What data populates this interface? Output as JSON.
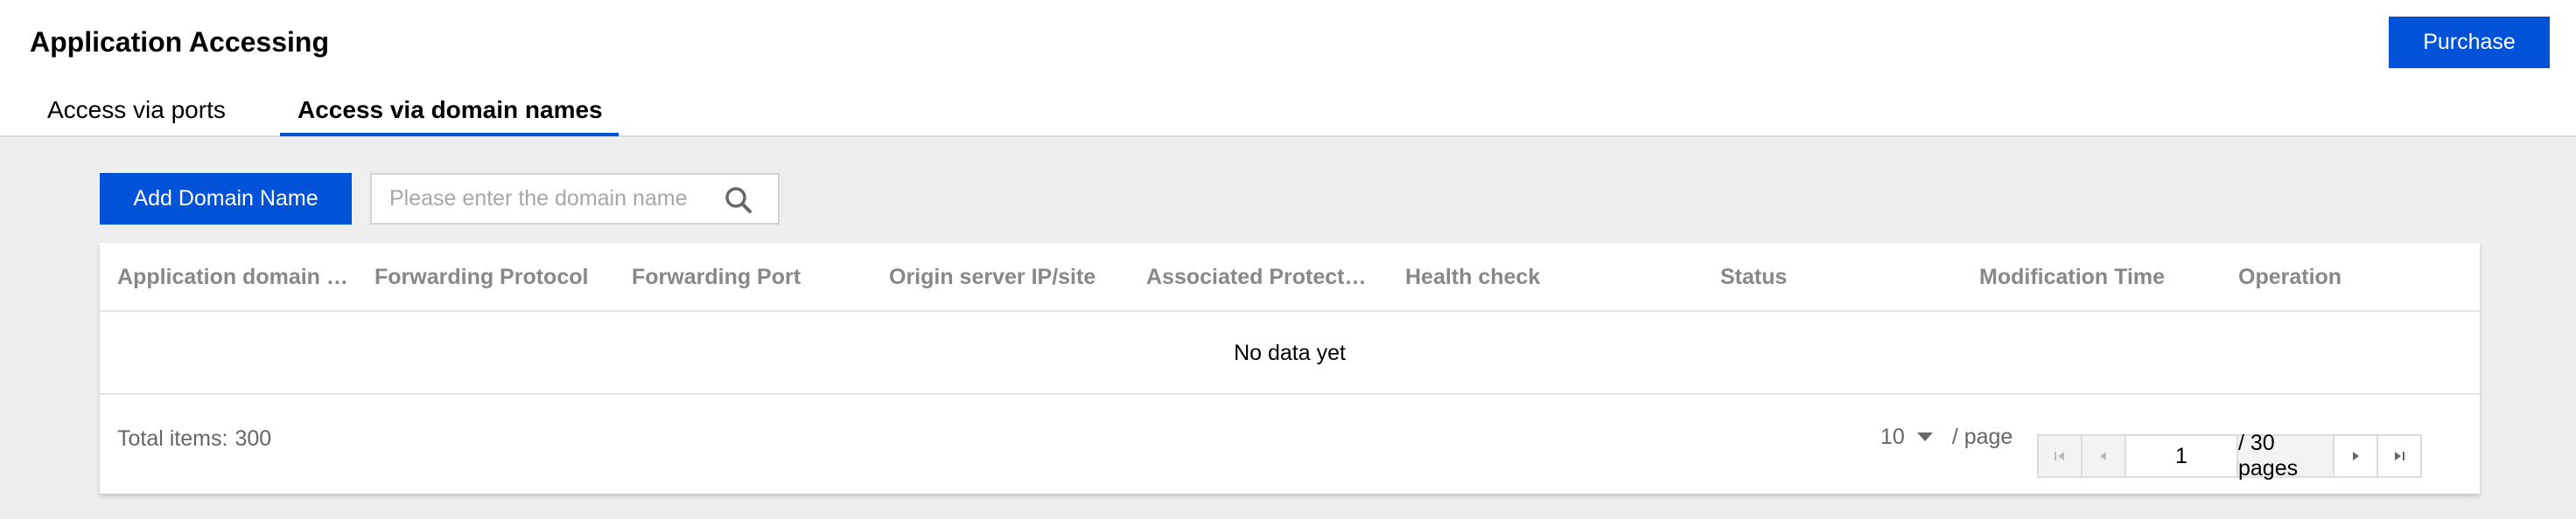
{
  "header": {
    "title": "Application Accessing",
    "purchase_label": "Purchase",
    "tabs": [
      {
        "label": "Access via ports",
        "active": false
      },
      {
        "label": "Access via domain names",
        "active": true
      }
    ]
  },
  "toolbar": {
    "add_label": "Add Domain Name",
    "search": {
      "placeholder": "Please enter the domain name",
      "value": "",
      "icon": "search-icon"
    }
  },
  "table": {
    "columns": [
      "Application domain name",
      "Forwarding Protocol",
      "Forwarding Port",
      "Origin server IP/site",
      "Associated Protection Package",
      "Health check",
      "Status",
      "Modification Time",
      "Operation"
    ],
    "rows": [],
    "empty_text": "No data yet"
  },
  "pagination": {
    "total_label": "Total items:",
    "total": "300",
    "page_size": "10",
    "page_size_suffix": "/ page",
    "current_page": "1",
    "pages_label": "/ 30 pages",
    "icons": [
      "first-page-icon",
      "prev-page-icon",
      "next-page-icon",
      "last-page-icon"
    ]
  },
  "colors": {
    "accent": "#0052d9",
    "background": "#eeeeee",
    "header_text": "#888888"
  }
}
